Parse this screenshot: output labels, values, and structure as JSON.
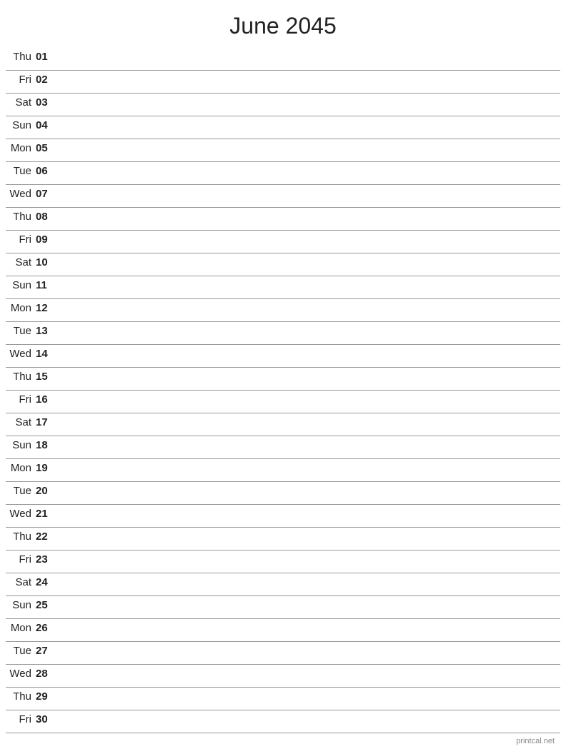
{
  "title": "June 2045",
  "footer": "printcal.net",
  "days": [
    {
      "name": "Thu",
      "number": "01"
    },
    {
      "name": "Fri",
      "number": "02"
    },
    {
      "name": "Sat",
      "number": "03"
    },
    {
      "name": "Sun",
      "number": "04"
    },
    {
      "name": "Mon",
      "number": "05"
    },
    {
      "name": "Tue",
      "number": "06"
    },
    {
      "name": "Wed",
      "number": "07"
    },
    {
      "name": "Thu",
      "number": "08"
    },
    {
      "name": "Fri",
      "number": "09"
    },
    {
      "name": "Sat",
      "number": "10"
    },
    {
      "name": "Sun",
      "number": "11"
    },
    {
      "name": "Mon",
      "number": "12"
    },
    {
      "name": "Tue",
      "number": "13"
    },
    {
      "name": "Wed",
      "number": "14"
    },
    {
      "name": "Thu",
      "number": "15"
    },
    {
      "name": "Fri",
      "number": "16"
    },
    {
      "name": "Sat",
      "number": "17"
    },
    {
      "name": "Sun",
      "number": "18"
    },
    {
      "name": "Mon",
      "number": "19"
    },
    {
      "name": "Tue",
      "number": "20"
    },
    {
      "name": "Wed",
      "number": "21"
    },
    {
      "name": "Thu",
      "number": "22"
    },
    {
      "name": "Fri",
      "number": "23"
    },
    {
      "name": "Sat",
      "number": "24"
    },
    {
      "name": "Sun",
      "number": "25"
    },
    {
      "name": "Mon",
      "number": "26"
    },
    {
      "name": "Tue",
      "number": "27"
    },
    {
      "name": "Wed",
      "number": "28"
    },
    {
      "name": "Thu",
      "number": "29"
    },
    {
      "name": "Fri",
      "number": "30"
    }
  ]
}
